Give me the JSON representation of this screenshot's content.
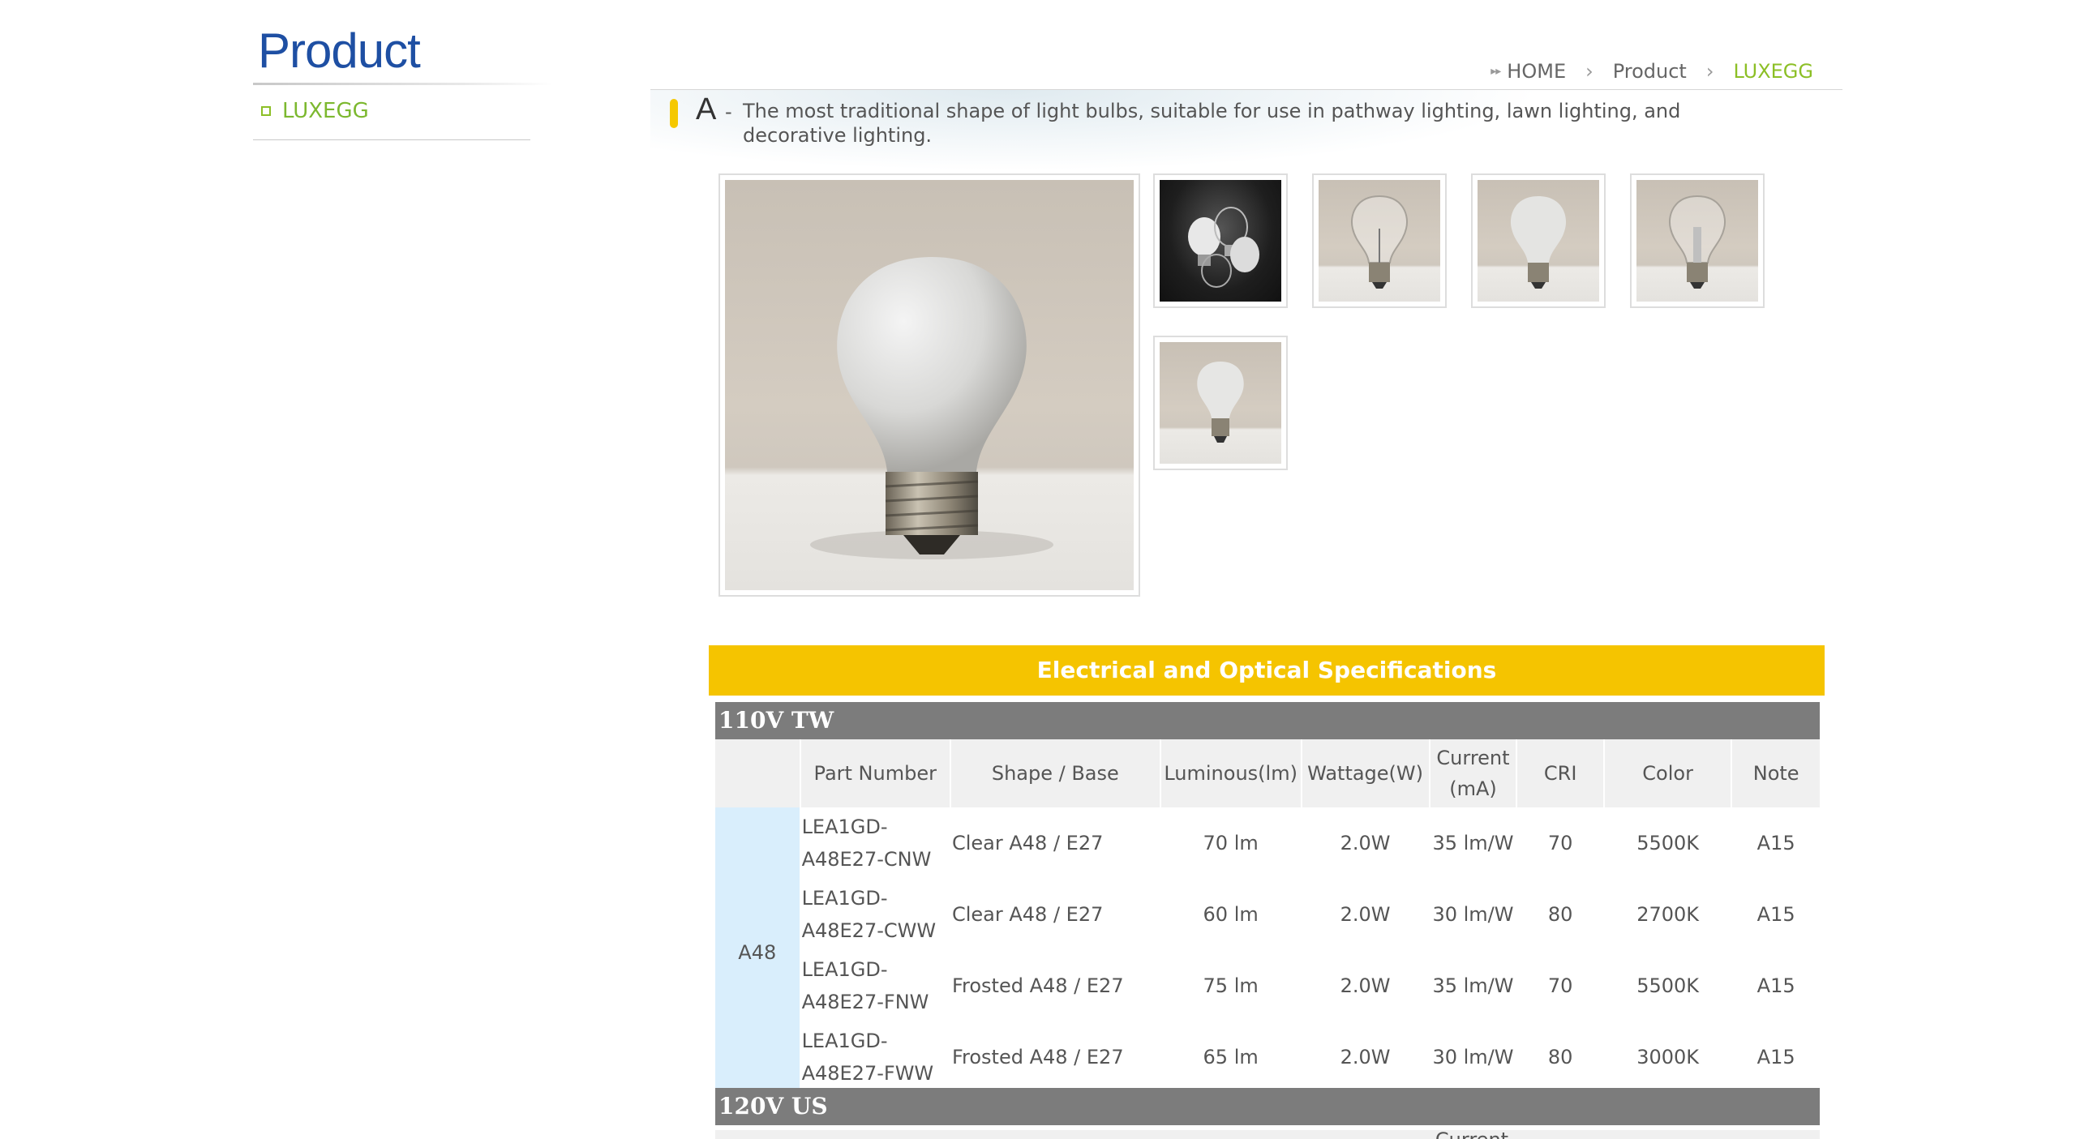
{
  "sidebar": {
    "title": "Product",
    "items": [
      {
        "label": "LUXEGG"
      }
    ]
  },
  "breadcrumb": [
    "HOME",
    "Product",
    "LUXEGG"
  ],
  "description": {
    "letter": "A",
    "dash": "-",
    "text": "The most traditional shape of light bulbs, suitable for use in pathway lighting, lawn lighting, and decorative lighting."
  },
  "images": {
    "main": "frosted-bulb-photo",
    "thumbnails": [
      "bulb-group-dark-photo",
      "clear-bulb-photo",
      "frosted-bulb-photo",
      "clear-bulb-filament-photo",
      "frosted-bulb-small-photo"
    ]
  },
  "specs": {
    "banner": "Electrical and Optical Specifications",
    "groups": [
      {
        "name": "110V TW",
        "columns": [
          "",
          "Part Number",
          "Shape / Base",
          "Luminous(lm)",
          "Wattage(W)",
          "Current (mA)",
          "CRI",
          "Color",
          "Note"
        ],
        "shape_group": "A48",
        "rows": [
          {
            "part": "LEA1GD-A48E27-CNW",
            "shape": "Clear A48 / E27",
            "lumen": "70 lm",
            "watt": "2.0W",
            "current": "35 lm/W",
            "cri": "70",
            "color": "5500K",
            "note": "A15"
          },
          {
            "part": "LEA1GD-A48E27-CWW",
            "shape": "Clear A48 / E27",
            "lumen": "60 lm",
            "watt": "2.0W",
            "current": "30 lm/W",
            "cri": "80",
            "color": "2700K",
            "note": "A15"
          },
          {
            "part": "LEA1GD-A48E27-FNW",
            "shape": "Frosted A48 / E27",
            "lumen": "75 lm",
            "watt": "2.0W",
            "current": "35 lm/W",
            "cri": "70",
            "color": "5500K",
            "note": "A15"
          },
          {
            "part": "LEA1GD-A48E27-FWW",
            "shape": "Frosted A48 / E27",
            "lumen": "65 lm",
            "watt": "2.0W",
            "current": "30 lm/W",
            "cri": "80",
            "color": "3000K",
            "note": "A15"
          }
        ]
      },
      {
        "name": "120V US",
        "columns_partial": "Current"
      }
    ]
  },
  "colors": {
    "brand_blue": "#1e4fa3",
    "accent_green": "#8cbf26",
    "banner_yellow": "#f5c400",
    "group_gray": "#7c7c7c",
    "group_cell_blue": "#d9eefc"
  }
}
